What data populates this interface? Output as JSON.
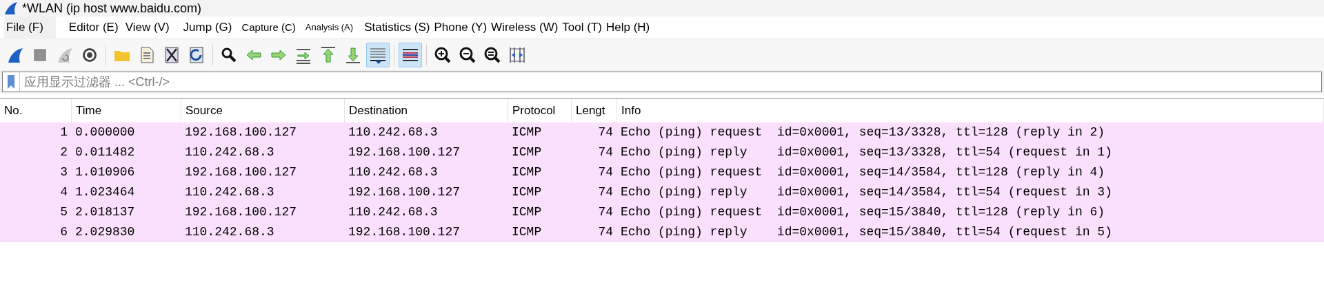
{
  "window": {
    "title": "*WLAN (ip host www.baidu.com)"
  },
  "menu": [
    {
      "label": "File (F)",
      "selected": true,
      "kind": "large"
    },
    {
      "label": "Editor (E)",
      "selected": false,
      "kind": "large"
    },
    {
      "label": "View (V)",
      "selected": false,
      "kind": "large"
    },
    {
      "label": "Jump (G)",
      "selected": false,
      "kind": "large"
    },
    {
      "label": "Capture (C)",
      "selected": false,
      "kind": "small"
    },
    {
      "label": "Analysis (A)",
      "selected": false,
      "kind": "tiny"
    },
    {
      "label": "Statistics (S)",
      "selected": false,
      "kind": "large"
    },
    {
      "label": "Phone (Y)",
      "selected": false,
      "kind": "large"
    },
    {
      "label": "Wireless (W)",
      "selected": false,
      "kind": "large"
    },
    {
      "label": "Tool (T)",
      "selected": false,
      "kind": "large"
    },
    {
      "label": "Help (H)",
      "selected": false,
      "kind": "large"
    }
  ],
  "toolbar": {
    "groups": [
      [
        {
          "pressed": false
        },
        {
          "pressed": false
        },
        {
          "pressed": false
        },
        {
          "pressed": false
        }
      ],
      [
        {
          "pressed": false
        },
        {
          "pressed": false
        },
        {
          "pressed": false
        },
        {
          "pressed": false
        }
      ],
      [
        {
          "pressed": false
        },
        {
          "pressed": false
        },
        {
          "pressed": false
        },
        {
          "pressed": false
        },
        {
          "pressed": false
        },
        {
          "pressed": false
        },
        {
          "pressed": true
        }
      ],
      [
        {
          "pressed": true
        }
      ],
      [
        {
          "pressed": false
        },
        {
          "pressed": false
        },
        {
          "pressed": false
        },
        {
          "pressed": false
        }
      ]
    ]
  },
  "filter": {
    "placeholder": "应用显示过滤器 ... <Ctrl-/>"
  },
  "table": {
    "columns": [
      "No.",
      "Time",
      "Source",
      "Destination",
      "Protocol",
      "Lengt",
      "Info"
    ],
    "rows": [
      {
        "cells": [
          "1",
          "0.000000",
          "192.168.100.127",
          "110.242.68.3",
          "ICMP",
          "74",
          "Echo (ping) request  id=0x0001, seq=13/3328, ttl=128 (reply in 2)"
        ],
        "color": "#fae0fc"
      },
      {
        "cells": [
          "2",
          "0.011482",
          "110.242.68.3",
          "192.168.100.127",
          "ICMP",
          "74",
          "Echo (ping) reply    id=0x0001, seq=13/3328, ttl=54 (request in 1)"
        ],
        "color": "#fae0fc"
      },
      {
        "cells": [
          "3",
          "1.010906",
          "192.168.100.127",
          "110.242.68.3",
          "ICMP",
          "74",
          "Echo (ping) request  id=0x0001, seq=14/3584, ttl=128 (reply in 4)"
        ],
        "color": "#fae0fc"
      },
      {
        "cells": [
          "4",
          "1.023464",
          "110.242.68.3",
          "192.168.100.127",
          "ICMP",
          "74",
          "Echo (ping) reply    id=0x0001, seq=14/3584, ttl=54 (request in 3)"
        ],
        "color": "#fae0fc"
      },
      {
        "cells": [
          "5",
          "2.018137",
          "192.168.100.127",
          "110.242.68.3",
          "ICMP",
          "74",
          "Echo (ping) request  id=0x0001, seq=15/3840, ttl=128 (reply in 6)"
        ],
        "color": "#fae0fc"
      },
      {
        "cells": [
          "6",
          "2.029830",
          "110.242.68.3",
          "192.168.100.127",
          "ICMP",
          "74",
          "Echo (ping) reply    id=0x0001, seq=15/3840, ttl=54 (request in 5)"
        ],
        "color": "#fae0fc"
      }
    ]
  }
}
